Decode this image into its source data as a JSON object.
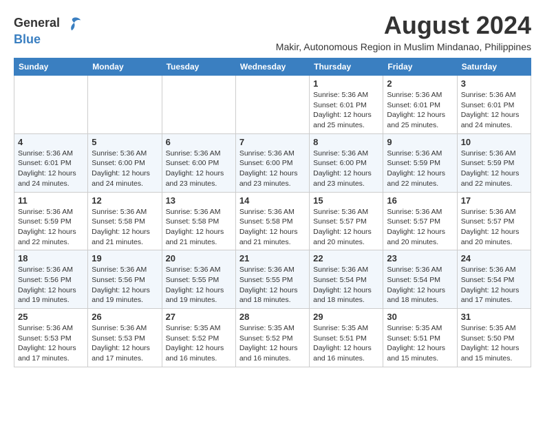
{
  "logo": {
    "line1": "General",
    "line2": "Blue"
  },
  "title": "August 2024",
  "subtitle": "Makir, Autonomous Region in Muslim Mindanao, Philippines",
  "days_header": [
    "Sunday",
    "Monday",
    "Tuesday",
    "Wednesday",
    "Thursday",
    "Friday",
    "Saturday"
  ],
  "weeks": [
    [
      {
        "day": "",
        "info": ""
      },
      {
        "day": "",
        "info": ""
      },
      {
        "day": "",
        "info": ""
      },
      {
        "day": "",
        "info": ""
      },
      {
        "day": "1",
        "info": "Sunrise: 5:36 AM\nSunset: 6:01 PM\nDaylight: 12 hours\nand 25 minutes."
      },
      {
        "day": "2",
        "info": "Sunrise: 5:36 AM\nSunset: 6:01 PM\nDaylight: 12 hours\nand 25 minutes."
      },
      {
        "day": "3",
        "info": "Sunrise: 5:36 AM\nSunset: 6:01 PM\nDaylight: 12 hours\nand 24 minutes."
      }
    ],
    [
      {
        "day": "4",
        "info": "Sunrise: 5:36 AM\nSunset: 6:01 PM\nDaylight: 12 hours\nand 24 minutes."
      },
      {
        "day": "5",
        "info": "Sunrise: 5:36 AM\nSunset: 6:00 PM\nDaylight: 12 hours\nand 24 minutes."
      },
      {
        "day": "6",
        "info": "Sunrise: 5:36 AM\nSunset: 6:00 PM\nDaylight: 12 hours\nand 23 minutes."
      },
      {
        "day": "7",
        "info": "Sunrise: 5:36 AM\nSunset: 6:00 PM\nDaylight: 12 hours\nand 23 minutes."
      },
      {
        "day": "8",
        "info": "Sunrise: 5:36 AM\nSunset: 6:00 PM\nDaylight: 12 hours\nand 23 minutes."
      },
      {
        "day": "9",
        "info": "Sunrise: 5:36 AM\nSunset: 5:59 PM\nDaylight: 12 hours\nand 22 minutes."
      },
      {
        "day": "10",
        "info": "Sunrise: 5:36 AM\nSunset: 5:59 PM\nDaylight: 12 hours\nand 22 minutes."
      }
    ],
    [
      {
        "day": "11",
        "info": "Sunrise: 5:36 AM\nSunset: 5:59 PM\nDaylight: 12 hours\nand 22 minutes."
      },
      {
        "day": "12",
        "info": "Sunrise: 5:36 AM\nSunset: 5:58 PM\nDaylight: 12 hours\nand 21 minutes."
      },
      {
        "day": "13",
        "info": "Sunrise: 5:36 AM\nSunset: 5:58 PM\nDaylight: 12 hours\nand 21 minutes."
      },
      {
        "day": "14",
        "info": "Sunrise: 5:36 AM\nSunset: 5:58 PM\nDaylight: 12 hours\nand 21 minutes."
      },
      {
        "day": "15",
        "info": "Sunrise: 5:36 AM\nSunset: 5:57 PM\nDaylight: 12 hours\nand 20 minutes."
      },
      {
        "day": "16",
        "info": "Sunrise: 5:36 AM\nSunset: 5:57 PM\nDaylight: 12 hours\nand 20 minutes."
      },
      {
        "day": "17",
        "info": "Sunrise: 5:36 AM\nSunset: 5:57 PM\nDaylight: 12 hours\nand 20 minutes."
      }
    ],
    [
      {
        "day": "18",
        "info": "Sunrise: 5:36 AM\nSunset: 5:56 PM\nDaylight: 12 hours\nand 19 minutes."
      },
      {
        "day": "19",
        "info": "Sunrise: 5:36 AM\nSunset: 5:56 PM\nDaylight: 12 hours\nand 19 minutes."
      },
      {
        "day": "20",
        "info": "Sunrise: 5:36 AM\nSunset: 5:55 PM\nDaylight: 12 hours\nand 19 minutes."
      },
      {
        "day": "21",
        "info": "Sunrise: 5:36 AM\nSunset: 5:55 PM\nDaylight: 12 hours\nand 18 minutes."
      },
      {
        "day": "22",
        "info": "Sunrise: 5:36 AM\nSunset: 5:54 PM\nDaylight: 12 hours\nand 18 minutes."
      },
      {
        "day": "23",
        "info": "Sunrise: 5:36 AM\nSunset: 5:54 PM\nDaylight: 12 hours\nand 18 minutes."
      },
      {
        "day": "24",
        "info": "Sunrise: 5:36 AM\nSunset: 5:54 PM\nDaylight: 12 hours\nand 17 minutes."
      }
    ],
    [
      {
        "day": "25",
        "info": "Sunrise: 5:36 AM\nSunset: 5:53 PM\nDaylight: 12 hours\nand 17 minutes."
      },
      {
        "day": "26",
        "info": "Sunrise: 5:36 AM\nSunset: 5:53 PM\nDaylight: 12 hours\nand 17 minutes."
      },
      {
        "day": "27",
        "info": "Sunrise: 5:35 AM\nSunset: 5:52 PM\nDaylight: 12 hours\nand 16 minutes."
      },
      {
        "day": "28",
        "info": "Sunrise: 5:35 AM\nSunset: 5:52 PM\nDaylight: 12 hours\nand 16 minutes."
      },
      {
        "day": "29",
        "info": "Sunrise: 5:35 AM\nSunset: 5:51 PM\nDaylight: 12 hours\nand 16 minutes."
      },
      {
        "day": "30",
        "info": "Sunrise: 5:35 AM\nSunset: 5:51 PM\nDaylight: 12 hours\nand 15 minutes."
      },
      {
        "day": "31",
        "info": "Sunrise: 5:35 AM\nSunset: 5:50 PM\nDaylight: 12 hours\nand 15 minutes."
      }
    ]
  ]
}
